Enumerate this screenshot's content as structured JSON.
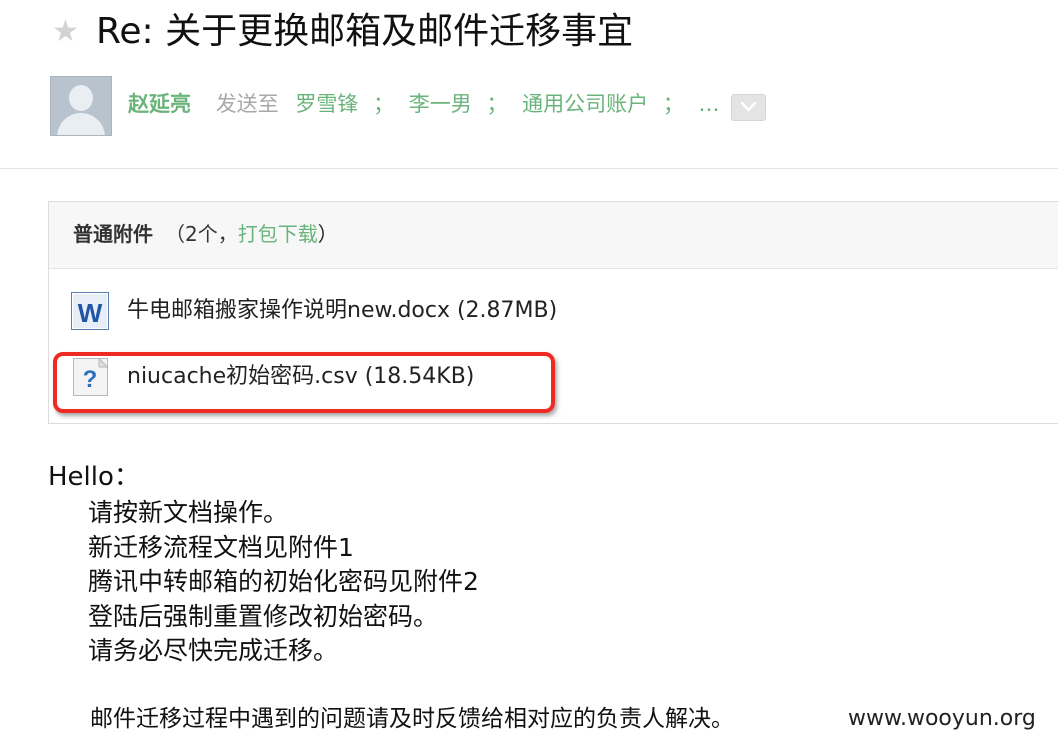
{
  "subject": "Re: 关于更换邮箱及邮件迁移事宜",
  "sender": {
    "name": "赵延亮",
    "sent_to_label": "发送至",
    "recipients": [
      "罗雪锋",
      "李一男",
      "通用公司账户",
      "…"
    ],
    "separator": "；"
  },
  "attachments": {
    "title": "普通附件",
    "count_prefix": "（2个，",
    "download_label": "打包下载",
    "count_suffix": "）",
    "files": [
      {
        "name": "牛电邮箱搬家操作说明new.docx (2.87MB)",
        "icon": "word-doc-icon"
      },
      {
        "name": "niucache初始密码.csv (18.54KB)",
        "icon": "unknown-file-icon"
      }
    ]
  },
  "body": {
    "greeting": "Hello：",
    "lines": [
      "请按新文档操作。",
      "新迁移流程文档见附件1",
      "腾讯中转邮箱的初始化密码见附件2",
      "登陆后强制重置修改初始密码。",
      "请务必尽快完成迁移。"
    ],
    "footer": "邮件迁移过程中遇到的问题请及时反馈给相对应的负责人解决。"
  },
  "watermark": "www.wooyun.org",
  "colors": {
    "accent_green": "#6ab47c",
    "highlight_red": "#ee2a23",
    "muted_gray": "#a8a8a8"
  }
}
